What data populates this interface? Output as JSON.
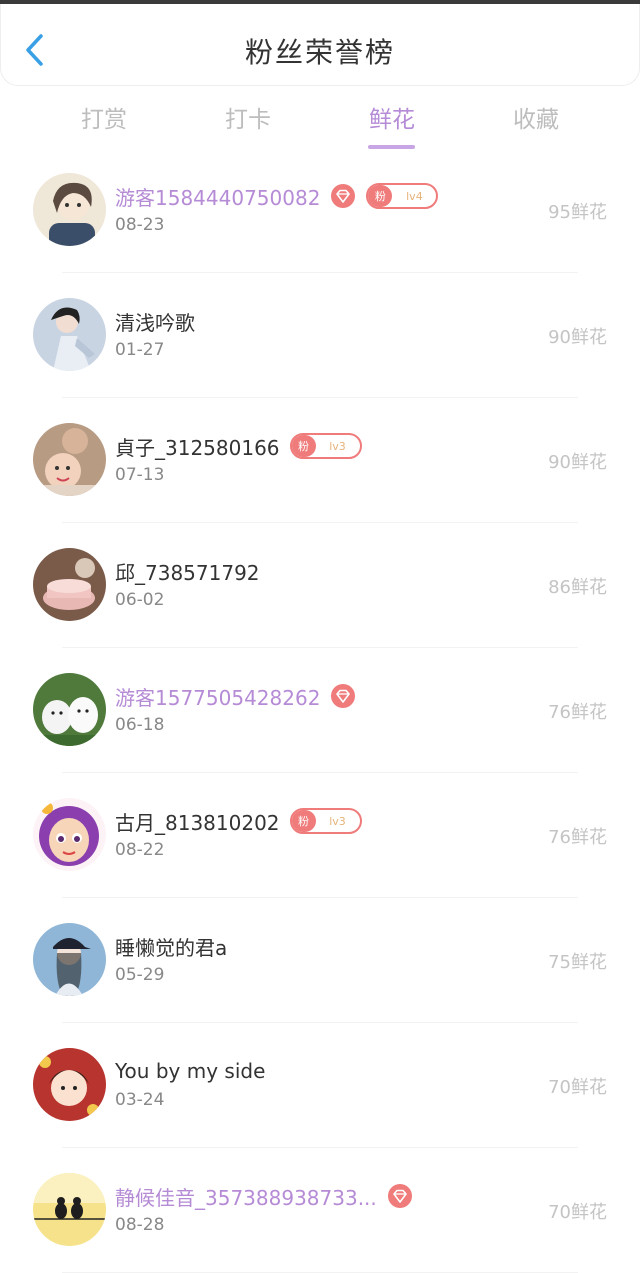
{
  "header": {
    "title": "粉丝荣誉榜"
  },
  "tabs": [
    {
      "label": "打赏",
      "active": false
    },
    {
      "label": "打卡",
      "active": false
    },
    {
      "label": "鲜花",
      "active": true
    },
    {
      "label": "收藏",
      "active": false
    }
  ],
  "fans": [
    {
      "name": "游客1584440750082",
      "purple": true,
      "diamond": true,
      "fan_label": "粉",
      "level": "lv4",
      "date": "08-23",
      "flowers": "95鲜花",
      "avatar": "girl-art"
    },
    {
      "name": "清浅吟歌",
      "purple": false,
      "diamond": false,
      "fan_label": "",
      "level": "",
      "date": "01-27",
      "flowers": "90鲜花",
      "avatar": "woman-dress"
    },
    {
      "name": "貞子_312580166",
      "purple": false,
      "diamond": false,
      "fan_label": "粉",
      "level": "lv3",
      "date": "07-13",
      "flowers": "90鲜花",
      "avatar": "family-photo"
    },
    {
      "name": "邱_738571792",
      "purple": false,
      "diamond": false,
      "fan_label": "",
      "level": "",
      "date": "06-02",
      "flowers": "86鲜花",
      "avatar": "cake-photo"
    },
    {
      "name": "游客1577505428262",
      "purple": true,
      "diamond": true,
      "fan_label": "",
      "level": "",
      "date": "06-18",
      "flowers": "76鲜花",
      "avatar": "white-dogs"
    },
    {
      "name": "古月_813810202",
      "purple": false,
      "diamond": false,
      "fan_label": "粉",
      "level": "lv3",
      "date": "08-22",
      "flowers": "76鲜花",
      "avatar": "cartoon-girl"
    },
    {
      "name": "睡懒觉的君a",
      "purple": false,
      "diamond": false,
      "fan_label": "",
      "level": "",
      "date": "05-29",
      "flowers": "75鲜花",
      "avatar": "girl-cap"
    },
    {
      "name": "You by my side",
      "purple": false,
      "diamond": false,
      "fan_label": "",
      "level": "",
      "date": "03-24",
      "flowers": "70鲜花",
      "avatar": "festive-girl"
    },
    {
      "name": "静候佳音_357388938733...",
      "purple": true,
      "diamond": true,
      "fan_label": "",
      "level": "",
      "date": "08-28",
      "flowers": "70鲜花",
      "avatar": "birds-sunset"
    }
  ],
  "colors": {
    "accent_purple": "#b68bd6",
    "badge_red": "#ef7b7b",
    "level_text": "#e7b37a",
    "back_arrow": "#3aa0e6"
  }
}
